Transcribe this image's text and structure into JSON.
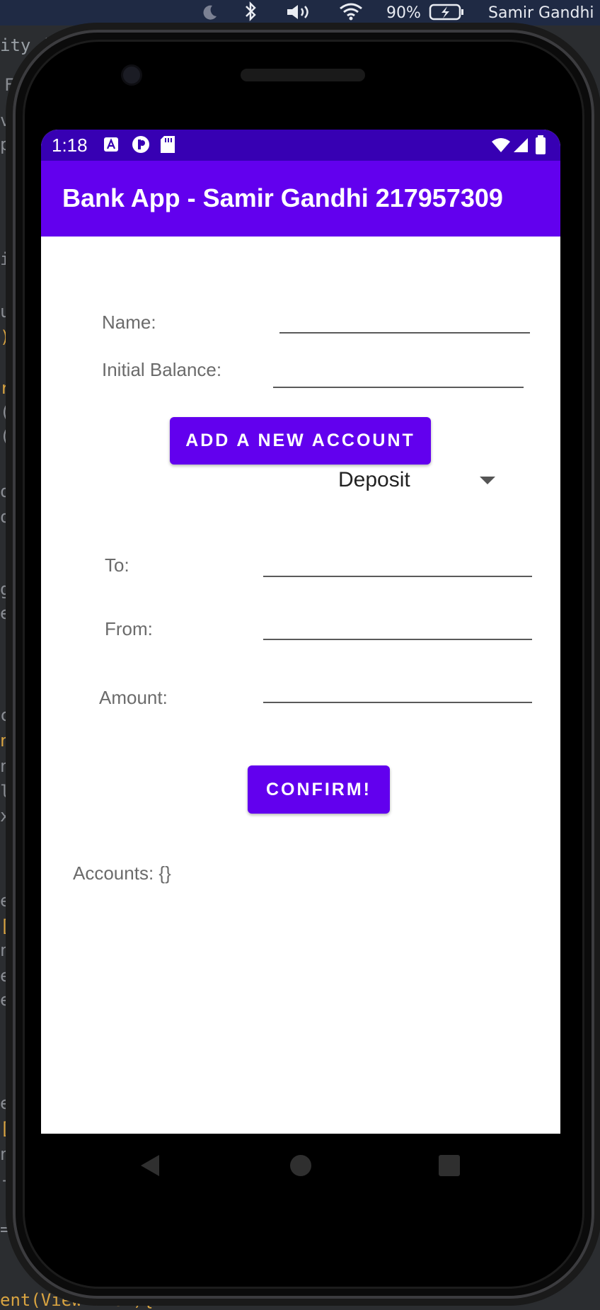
{
  "menubar": {
    "battery_percent": "90%",
    "user_name": "Samir Gandhi"
  },
  "ide": {
    "code_fragments": [
      "ity.j",
      "F",
      "vi",
      "pa",
      "it",
      "u",
      ")",
      "re",
      "(s",
      "(F",
      "o",
      "o",
      "g",
      "ex",
      "cs",
      "nt",
      "nd",
      "le",
      "xt",
      "et",
      "[I",
      "nd",
      "ex",
      "e",
      "et",
      "[I",
      "nd",
      "-",
      "=",
      "ent(View view){",
      "e"
    ]
  },
  "status_bar": {
    "time": "1:18"
  },
  "app_bar": {
    "title": "Bank App - Samir Gandhi 217957309"
  },
  "form": {
    "name_label": "Name:",
    "name_value": "",
    "balance_label": "Initial Balance:",
    "balance_value": "",
    "add_account_button": "ADD A NEW ACCOUNT",
    "transaction_type": "Deposit",
    "to_label": "To:",
    "to_value": "",
    "from_label": "From:",
    "from_value": "",
    "amount_label": "Amount:",
    "amount_value": "",
    "confirm_button": "CONFIRM!",
    "accounts_text": "Accounts: {}"
  },
  "colors": {
    "primary": "#6200ee",
    "primary_dark": "#3700b3"
  }
}
